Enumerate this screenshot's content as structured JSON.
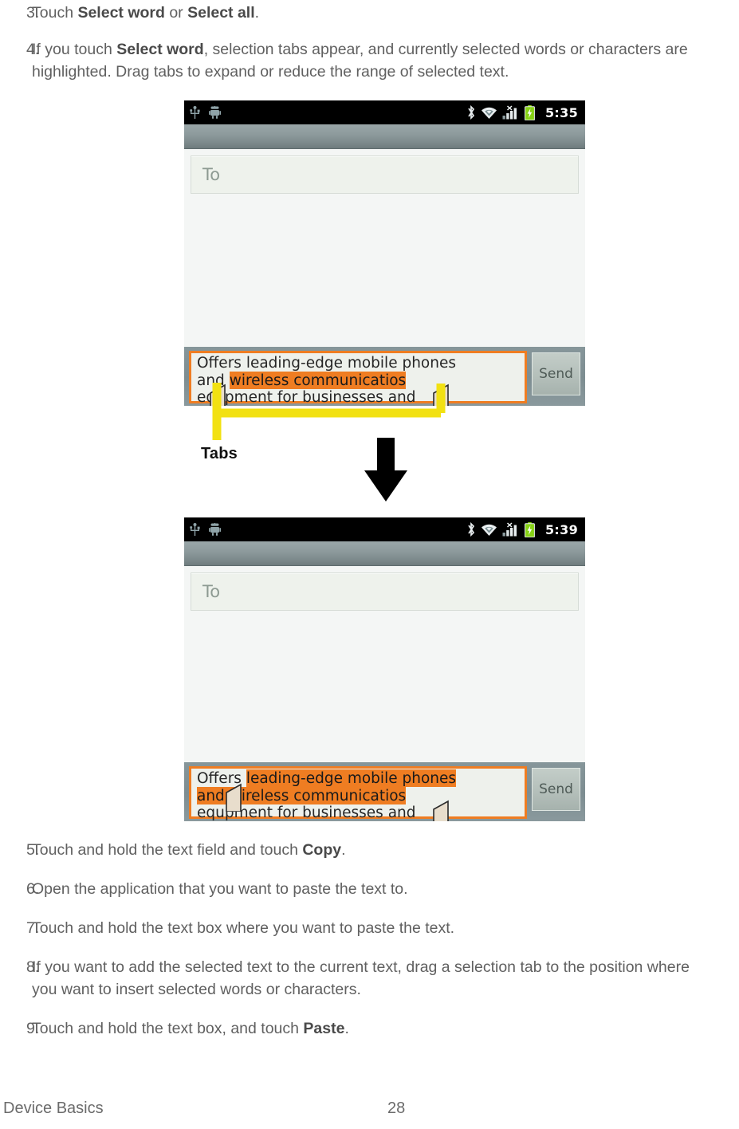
{
  "document": {
    "footer": {
      "section": "Device Basics",
      "page_number": "28"
    }
  },
  "steps_top": [
    {
      "number": "3.",
      "parts": [
        {
          "t": "Touch ",
          "b": false
        },
        {
          "t": "Select word",
          "b": true
        },
        {
          "t": " or ",
          "b": false
        },
        {
          "t": "Select all",
          "b": true
        },
        {
          "t": ".",
          "b": false
        }
      ]
    },
    {
      "number": "4.",
      "parts": [
        {
          "t": "If you touch ",
          "b": false
        },
        {
          "t": "Select word",
          "b": true
        },
        {
          "t": ", selection tabs appear, and currently selected words or characters are highlighted. Drag tabs to expand or reduce the range of selected text.",
          "b": false
        }
      ]
    }
  ],
  "steps_bottom": [
    {
      "number": "5.",
      "parts": [
        {
          "t": "Touch and hold the text field and touch ",
          "b": false
        },
        {
          "t": "Copy",
          "b": true
        },
        {
          "t": ".",
          "b": false
        }
      ]
    },
    {
      "number": "6.",
      "parts": [
        {
          "t": "Open the application that you want to paste the text to.",
          "b": false
        }
      ]
    },
    {
      "number": "7.",
      "parts": [
        {
          "t": "Touch and hold the text box where you want to paste the text.",
          "b": false
        }
      ]
    },
    {
      "number": "8.",
      "parts": [
        {
          "t": "If you want to add the selected text to the current text, drag a selection tab to the position where you want to insert selected words or characters.",
          "b": false
        }
      ]
    },
    {
      "number": "9.",
      "parts": [
        {
          "t": "Touch and hold the text box, and touch ",
          "b": false
        },
        {
          "t": "Paste",
          "b": true
        },
        {
          "t": ".",
          "b": false
        }
      ]
    }
  ],
  "figure": {
    "callout_label": "Tabs",
    "arrow": "down-arrow",
    "bracket_color": "#f2e112",
    "selection_color": "#ef7d22",
    "phone_top": {
      "statusbar": {
        "left_icons": [
          "usb-icon",
          "android-robot-icon"
        ],
        "right_icons": [
          "bluetooth-icon",
          "wifi-icon",
          "signal-bars-no-service-icon",
          "battery-charging-icon"
        ],
        "time": "5:35"
      },
      "to_field": {
        "placeholder": "To",
        "value": ""
      },
      "message_lines": [
        [
          {
            "t": "Offers leading-edge mobile phones",
            "hl": false
          }
        ],
        [
          {
            "t": "and ",
            "hl": false
          },
          {
            "t": "wireless communicatios",
            "hl": true
          }
        ],
        [
          {
            "t": "equpment for businesses and",
            "hl": false
          }
        ]
      ],
      "send_label": "Send"
    },
    "phone_bottom": {
      "statusbar": {
        "left_icons": [
          "usb-icon",
          "android-robot-icon"
        ],
        "right_icons": [
          "bluetooth-icon",
          "wifi-icon",
          "signal-bars-no-service-icon",
          "battery-charging-icon"
        ],
        "time": "5:39"
      },
      "to_field": {
        "placeholder": "To",
        "value": ""
      },
      "message_lines": [
        [
          {
            "t": "Offers ",
            "hl": false
          },
          {
            "t": "leading-edge mobile phones",
            "hl": true
          }
        ],
        [
          {
            "t": "and wireless communicatios",
            "hl": true
          }
        ],
        [
          {
            "t": "equpment for businesses and",
            "hl": false
          }
        ]
      ],
      "send_label": "Send"
    }
  }
}
